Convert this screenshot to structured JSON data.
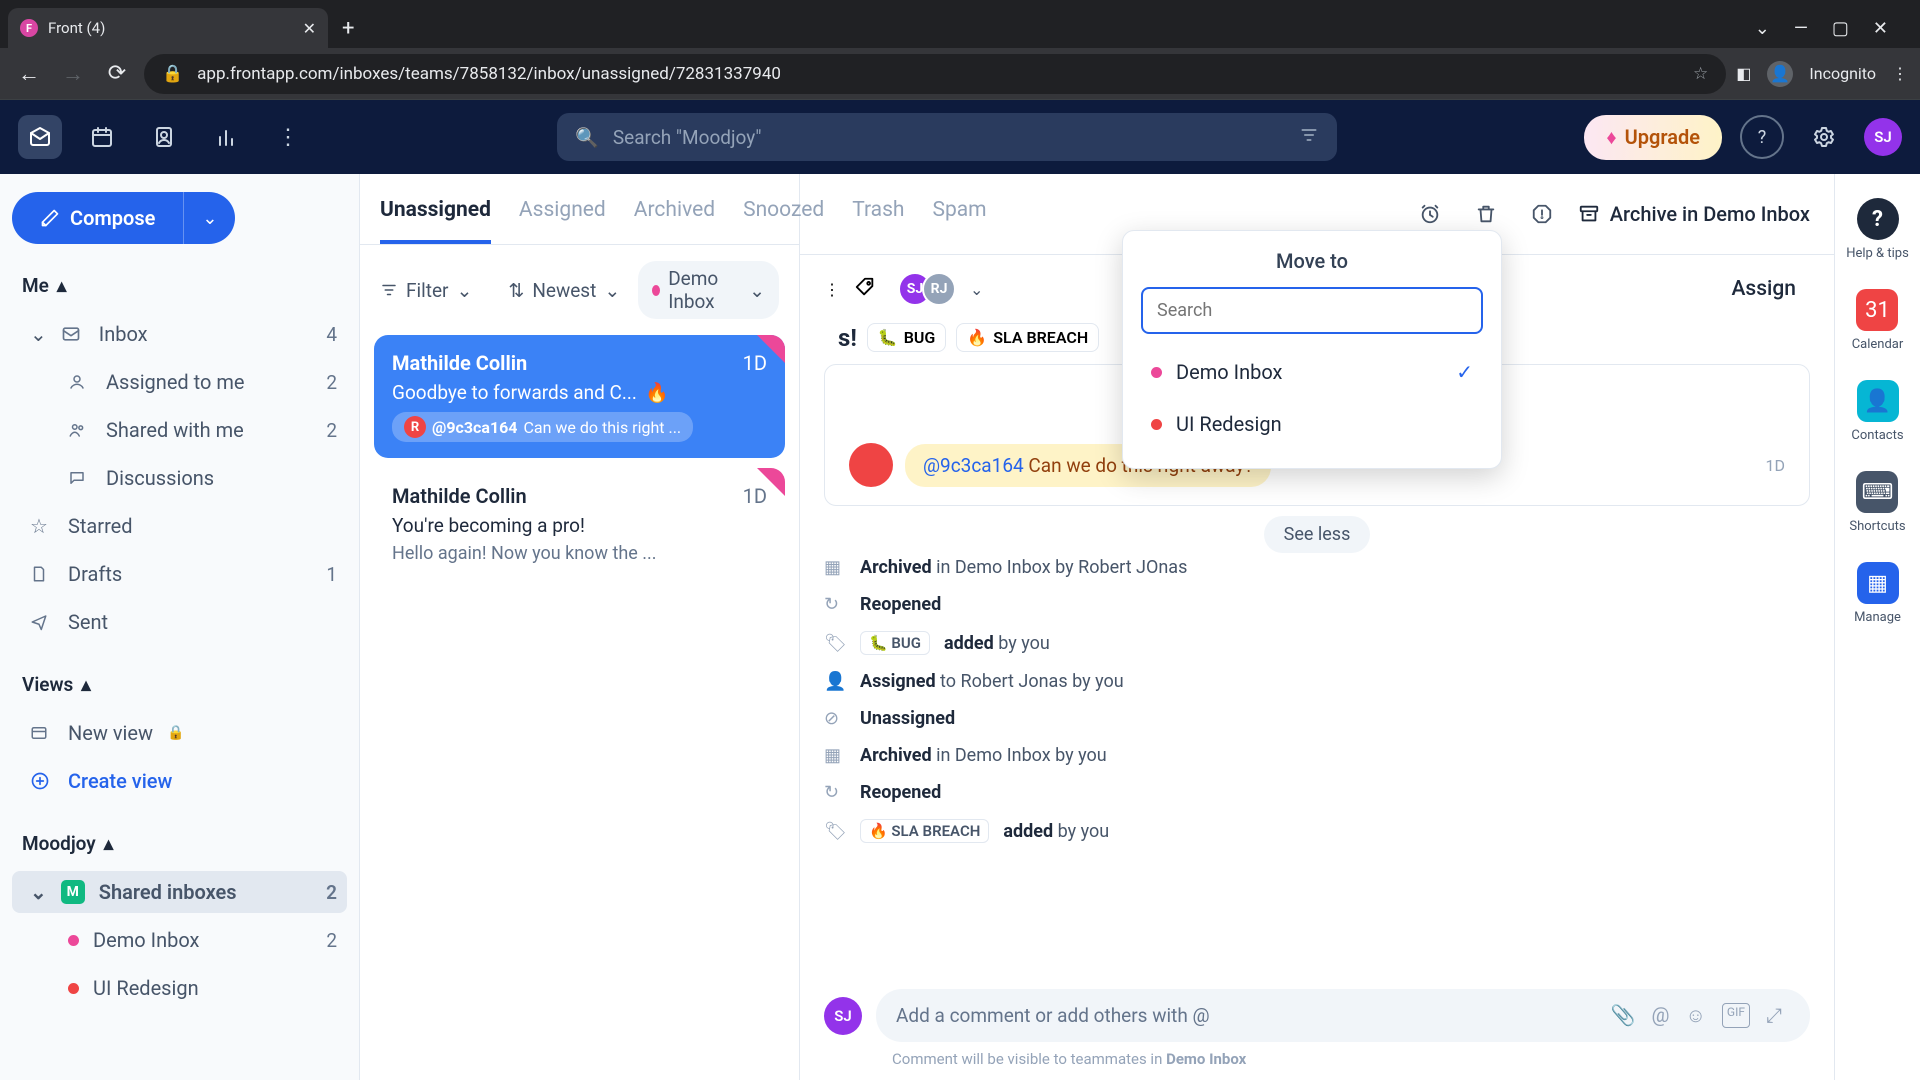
{
  "browser": {
    "tab_title": "Front (4)",
    "url": "app.frontapp.com/inboxes/teams/7858132/inbox/unassigned/72831337940",
    "incognito_label": "Incognito"
  },
  "header": {
    "search_placeholder": "Search \"Moodjoy\"",
    "upgrade": "Upgrade",
    "avatar": "SJ"
  },
  "sidebar": {
    "compose": "Compose",
    "me_label": "Me",
    "items": [
      {
        "label": "Inbox",
        "count": "4"
      },
      {
        "label": "Assigned to me",
        "count": "2"
      },
      {
        "label": "Shared with me",
        "count": "2"
      },
      {
        "label": "Discussions",
        "count": ""
      }
    ],
    "starred": "Starred",
    "drafts": "Drafts",
    "drafts_count": "1",
    "sent": "Sent",
    "views_label": "Views",
    "new_view": "New view",
    "create_view": "Create view",
    "moodjoy_label": "Moodjoy",
    "shared_inboxes": "Shared inboxes",
    "shared_count": "2",
    "demo_inbox": "Demo Inbox",
    "demo_count": "2",
    "ui_redesign": "UI Redesign"
  },
  "convo": {
    "tabs": [
      "Unassigned",
      "Assigned",
      "Archived",
      "Snoozed",
      "Trash",
      "Spam"
    ],
    "filter": "Filter",
    "sort": "Newest",
    "inbox_pill": "Demo Inbox",
    "items": [
      {
        "sender": "Mathilde Collin",
        "age": "1D",
        "subject": "Goodbye to forwards and C...",
        "mention_handle": "@9c3ca164",
        "mention_text": "Can we do this right ..."
      },
      {
        "sender": "Mathilde Collin",
        "age": "1D",
        "subject": "You're becoming a pro!",
        "snippet": "Hello again! Now you know the ..."
      }
    ]
  },
  "detail": {
    "archive_in": "Archive in Demo Inbox",
    "subject_fragment": "s!",
    "tag_bug": "BUG",
    "tag_sla": "SLA BREACH",
    "assignees": [
      "SJ",
      "RJ"
    ],
    "assign": "Assign",
    "comment_handle": "@9c3ca164",
    "comment_text": "Can we do this right away?",
    "comment_age": "1D",
    "see_less": "See less",
    "activity": [
      {
        "icon": "archive",
        "html": [
          "Archived",
          " in Demo Inbox by Robert JOnas"
        ]
      },
      {
        "icon": "reopen",
        "html": [
          "Reopened",
          ""
        ]
      },
      {
        "icon": "tag",
        "tag": "🐛 BUG",
        "html": [
          "added",
          " by you"
        ]
      },
      {
        "icon": "assign",
        "html": [
          "Assigned",
          " to Robert Jonas by you"
        ]
      },
      {
        "icon": "unassign",
        "html": [
          "Unassigned",
          ""
        ]
      },
      {
        "icon": "archive",
        "html": [
          "Archived",
          " in Demo Inbox by you"
        ]
      },
      {
        "icon": "reopen",
        "html": [
          "Reopened",
          ""
        ]
      },
      {
        "icon": "tag",
        "tag": "🔥 SLA BREACH",
        "html": [
          "added",
          " by you"
        ]
      }
    ],
    "composer_placeholder": "Add a comment or add others with @",
    "composer_note_prefix": "Comment will be visible to teammates in ",
    "composer_note_inbox": "Demo Inbox"
  },
  "moveto": {
    "title": "Move to",
    "search_placeholder": "Search",
    "options": [
      {
        "label": "Demo Inbox",
        "color": "pink",
        "selected": true
      },
      {
        "label": "UI Redesign",
        "color": "red",
        "selected": false
      }
    ]
  },
  "rail": {
    "help": "Help & tips",
    "calendar": "Calendar",
    "contacts": "Contacts",
    "shortcuts": "Shortcuts",
    "manage": "Manage"
  }
}
